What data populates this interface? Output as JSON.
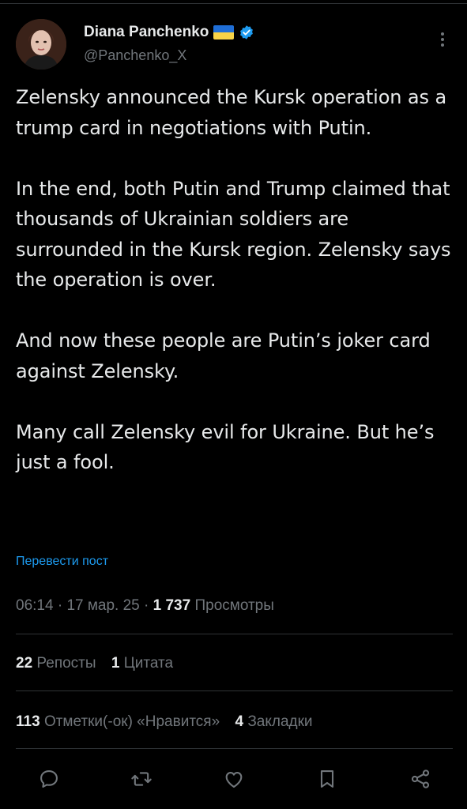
{
  "author": {
    "display_name": "Diana Panchenko",
    "handle": "@Panchenko_X",
    "flag_icon": "ukraine-flag-icon",
    "verified_icon": "verified-badge-icon",
    "verified_color": "#1d9bf0"
  },
  "post": {
    "paragraphs": [
      "Zelensky announced the Kursk operation as a trump card in negotiations with Putin.",
      "In the end, both Putin and Trump claimed that thousands of Ukrainian soldiers are surrounded in the Kursk region. Zelensky says the operation is over.",
      "And now these people are Putin’s joker card against Zelensky.",
      "Many call Zelensky evil for Ukraine. But he’s just a fool."
    ],
    "translate_label": "Перевести пост"
  },
  "meta": {
    "time": "06:14",
    "separator": "·",
    "date": "17 мар. 25",
    "views_count": "1 737",
    "views_label": "Просмотры"
  },
  "stats": {
    "reposts_count": "22",
    "reposts_label": "Репосты",
    "quotes_count": "1",
    "quotes_label": "Цитата",
    "likes_count": "113",
    "likes_label": "Отметки(-ок) «Нравится»",
    "bookmarks_count": "4",
    "bookmarks_label": "Закладки"
  },
  "actions": [
    "reply-icon",
    "repost-icon",
    "like-icon",
    "bookmark-icon",
    "share-icon"
  ],
  "colors": {
    "background": "#000000",
    "text": "#e7e9ea",
    "secondary": "#71767b",
    "accent": "#1d9bf0",
    "divider": "#2f3336"
  }
}
